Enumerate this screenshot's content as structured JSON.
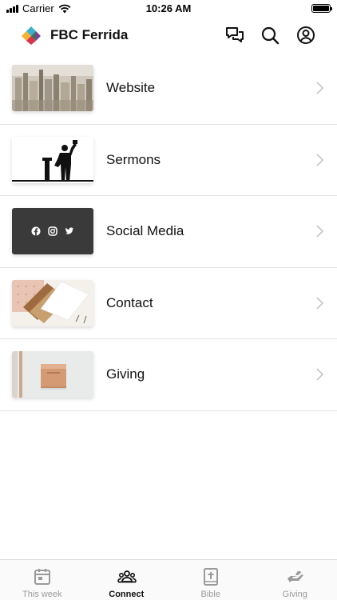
{
  "status_bar": {
    "carrier": "Carrier",
    "time": "10:26 AM"
  },
  "header": {
    "title": "FBC Ferrida",
    "icons": [
      "chat-icon",
      "search-icon",
      "profile-icon"
    ]
  },
  "items": [
    {
      "label": "Website",
      "thumb": "city-skyline-photo"
    },
    {
      "label": "Sermons",
      "thumb": "preacher-silhouette"
    },
    {
      "label": "Social Media",
      "thumb": "social-icons-tile",
      "icons": [
        "facebook-icon",
        "instagram-icon",
        "twitter-icon"
      ]
    },
    {
      "label": "Contact",
      "thumb": "cards-desk-photo"
    },
    {
      "label": "Giving",
      "thumb": "wall-mailbox-photo"
    }
  ],
  "tabs": [
    {
      "label": "This week",
      "icon": "calendar-icon",
      "active": false
    },
    {
      "label": "Connect",
      "icon": "people-icon",
      "active": true
    },
    {
      "label": "Bible",
      "icon": "bible-icon",
      "active": false
    },
    {
      "label": "Giving",
      "icon": "giving-hand-icon",
      "active": false
    }
  ],
  "colors": {
    "text": "#111111",
    "inactive_tab": "#9a9a9a",
    "divider": "#e6e6e6",
    "social_tile": "#3a3a3a"
  }
}
